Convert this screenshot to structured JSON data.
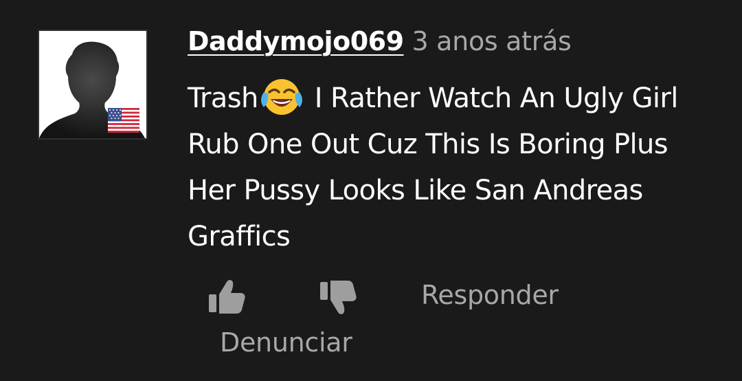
{
  "comment": {
    "author": "Daddymojo069",
    "timestamp": "3 anos atrás",
    "text": {
      "line1_before_emoji": "Trash",
      "line1_after_emoji": "I Rather Watch An Ugly Girl",
      "line2": "Rub One Out Cuz This Is Boring Plus",
      "line3": "Her Pussy Looks Like San Andreas",
      "line4": "Graffics"
    },
    "emoji": "face-with-tears-of-joy",
    "avatar_icon": "default-profile-silhouette",
    "country_flag": "us-flag-icon"
  },
  "actions": {
    "like_icon": "thumbs-up-icon",
    "dislike_icon": "thumbs-down-icon",
    "reply_label": "Responder",
    "report_label": "Denunciar"
  },
  "colors": {
    "background": "#1a1a1b",
    "text_primary": "#ffffff",
    "text_secondary": "#a8a8a8",
    "icon": "#9e9e9e"
  }
}
